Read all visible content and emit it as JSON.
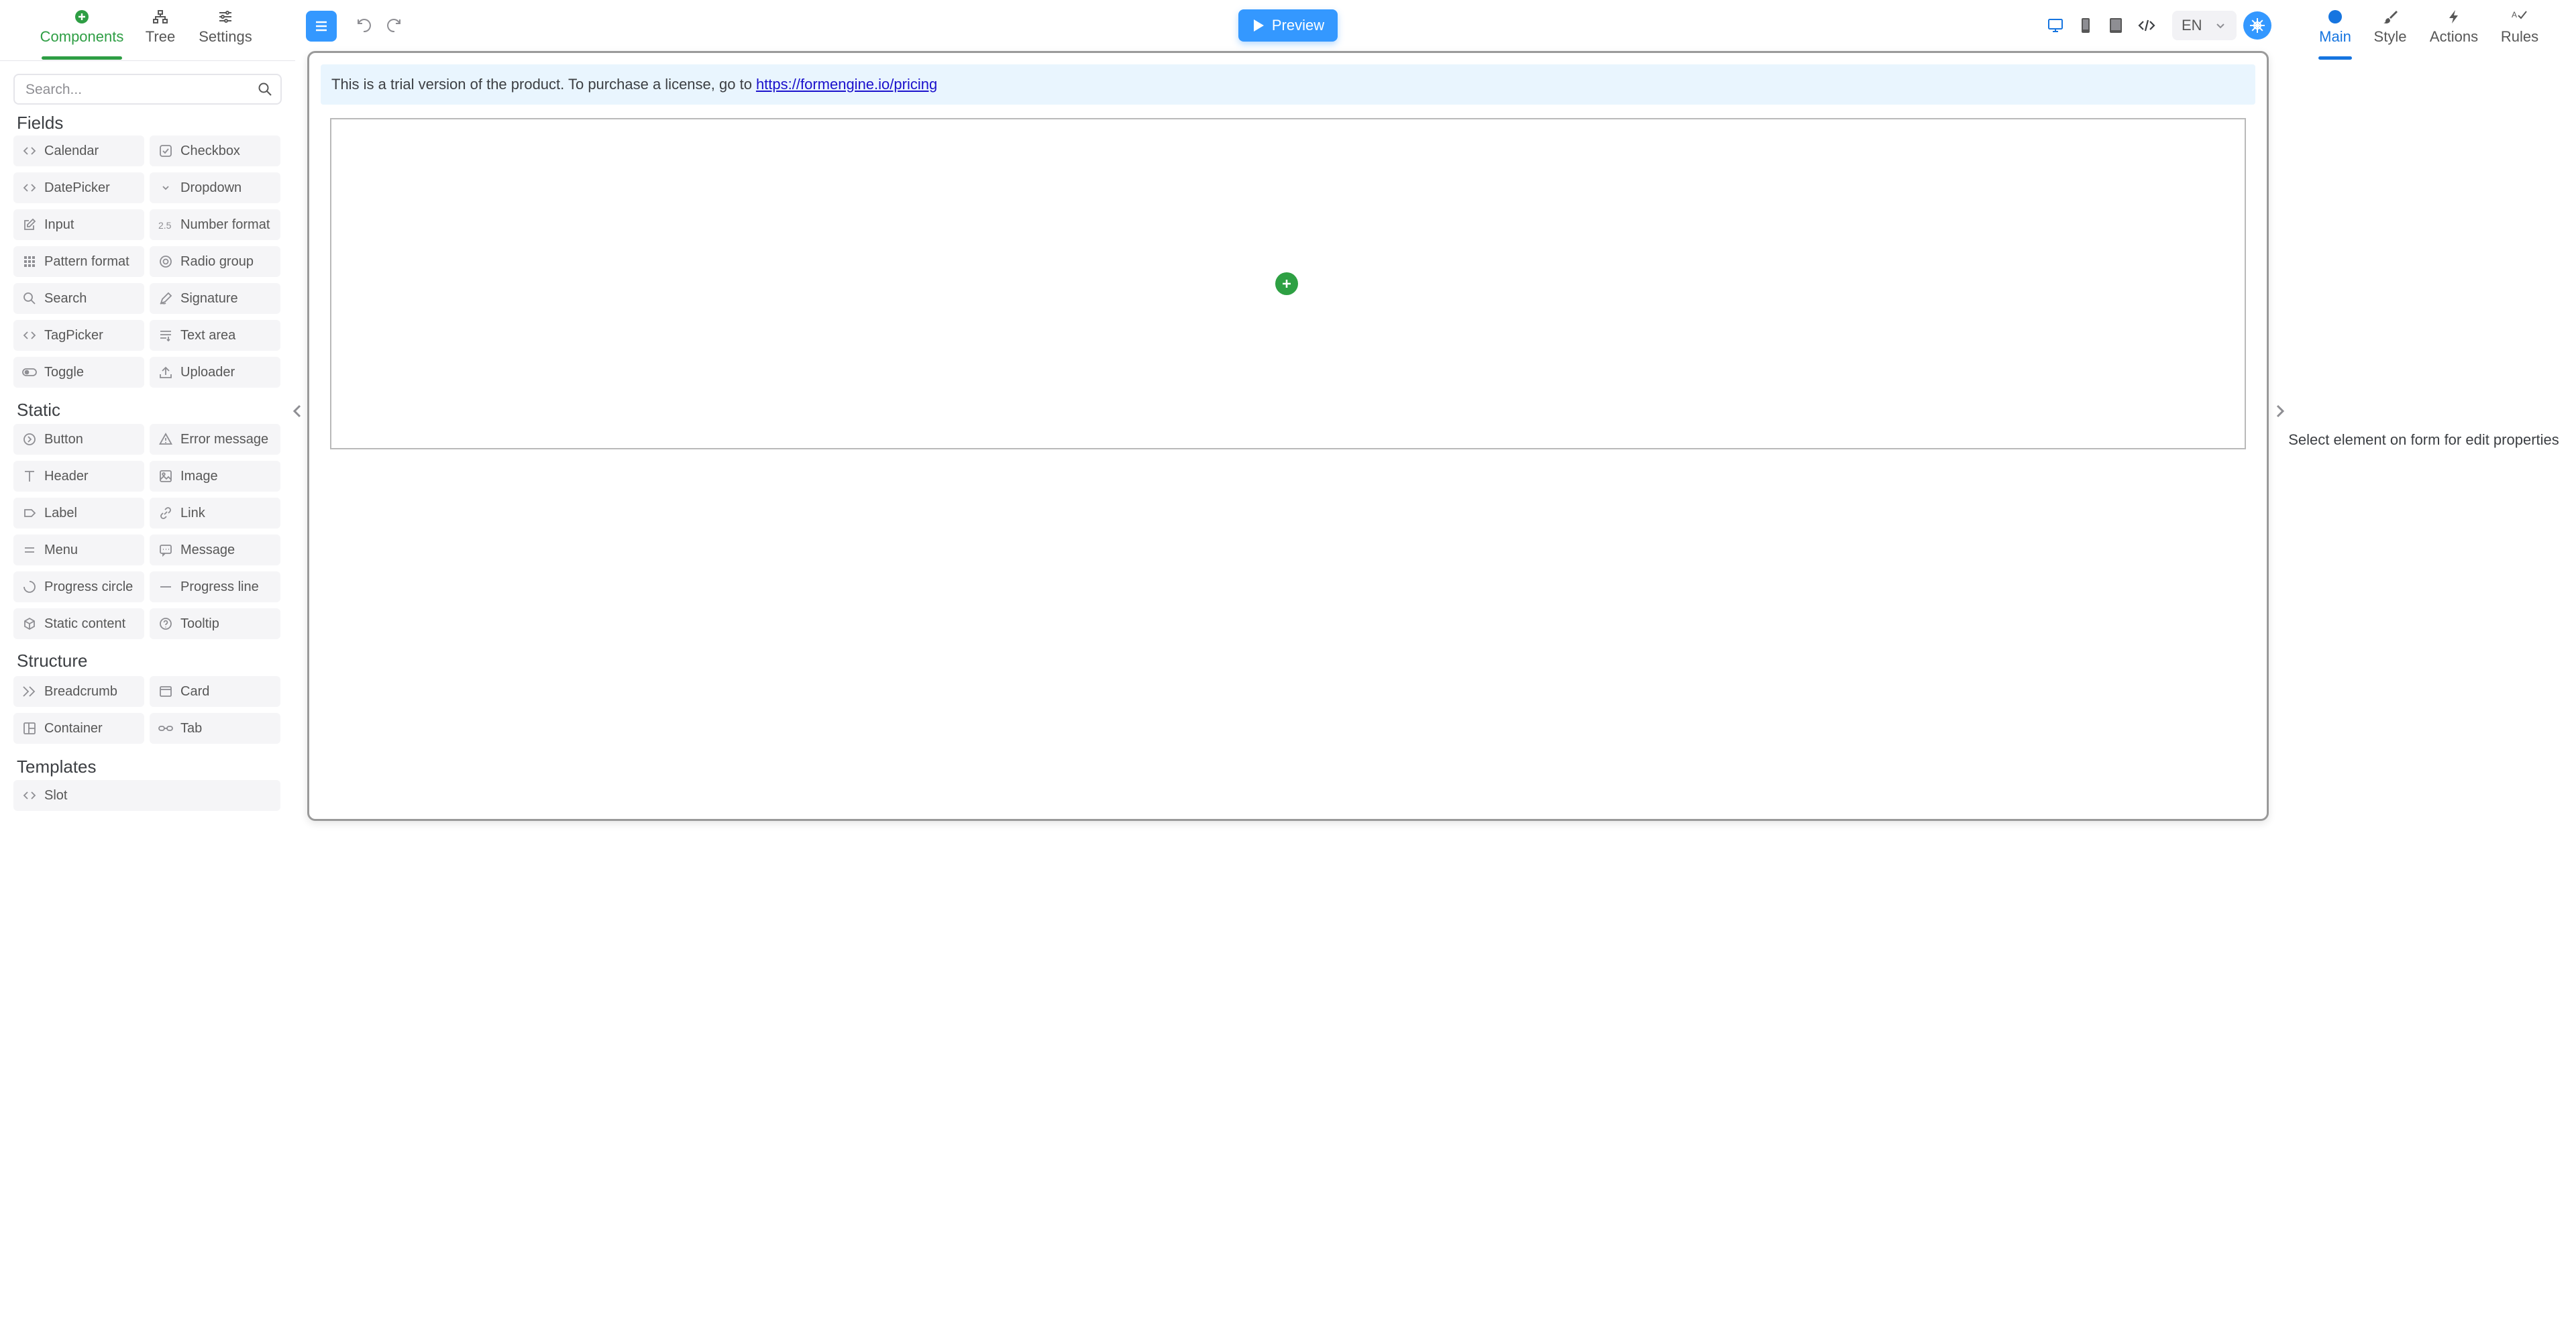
{
  "left_panel": {
    "tabs": [
      {
        "label": "Components",
        "icon": "plus-circle-icon",
        "active": true
      },
      {
        "label": "Tree",
        "icon": "tree-icon",
        "active": false
      },
      {
        "label": "Settings",
        "icon": "sliders-icon",
        "active": false
      }
    ],
    "search": {
      "placeholder": "Search...",
      "value": ""
    },
    "sections": {
      "fields": {
        "title": "Fields",
        "items": [
          {
            "label": "Calendar",
            "icon": "code-icon"
          },
          {
            "label": "Checkbox",
            "icon": "checkbox-icon"
          },
          {
            "label": "DatePicker",
            "icon": "code-icon"
          },
          {
            "label": "Dropdown",
            "icon": "chevron-down-icon"
          },
          {
            "label": "Input",
            "icon": "edit-icon"
          },
          {
            "label": "Number format",
            "icon": "number-icon"
          },
          {
            "label": "Pattern format",
            "icon": "grid-dots-icon"
          },
          {
            "label": "Radio group",
            "icon": "radio-icon"
          },
          {
            "label": "Search",
            "icon": "search-icon"
          },
          {
            "label": "Signature",
            "icon": "pen-icon"
          },
          {
            "label": "TagPicker",
            "icon": "code-icon"
          },
          {
            "label": "Text area",
            "icon": "text-lines-icon"
          },
          {
            "label": "Toggle",
            "icon": "toggle-icon"
          },
          {
            "label": "Uploader",
            "icon": "upload-icon"
          }
        ]
      },
      "static": {
        "title": "Static",
        "items": [
          {
            "label": "Button",
            "icon": "button-icon"
          },
          {
            "label": "Error message",
            "icon": "warning-icon"
          },
          {
            "label": "Header",
            "icon": "header-icon"
          },
          {
            "label": "Image",
            "icon": "image-icon"
          },
          {
            "label": "Label",
            "icon": "label-icon"
          },
          {
            "label": "Link",
            "icon": "link-icon"
          },
          {
            "label": "Menu",
            "icon": "menu-icon"
          },
          {
            "label": "Message",
            "icon": "message-icon"
          },
          {
            "label": "Progress circle",
            "icon": "progress-circle-icon"
          },
          {
            "label": "Progress line",
            "icon": "progress-line-icon"
          },
          {
            "label": "Static content",
            "icon": "cube-icon"
          },
          {
            "label": "Tooltip",
            "icon": "help-icon"
          }
        ]
      },
      "structure": {
        "title": "Structure",
        "items": [
          {
            "label": "Breadcrumb",
            "icon": "breadcrumb-icon"
          },
          {
            "label": "Card",
            "icon": "card-icon"
          },
          {
            "label": "Container",
            "icon": "container-icon"
          },
          {
            "label": "Tab",
            "icon": "tab-icon"
          }
        ]
      },
      "templates": {
        "title": "Templates",
        "items": [
          {
            "label": "Slot",
            "icon": "code-icon"
          }
        ]
      }
    }
  },
  "toolbar": {
    "menu_icon": "hamburger-icon",
    "undo_icon": "undo-icon",
    "redo_icon": "redo-icon",
    "preview_label": "Preview",
    "devices": [
      "desktop-icon",
      "mobile-icon",
      "tablet-icon",
      "code-icon"
    ],
    "active_device": "desktop-icon",
    "language": "EN",
    "theme_icon": "snowflake-icon"
  },
  "right_panel": {
    "tabs": [
      {
        "label": "Main",
        "icon": "circle-icon",
        "active": true
      },
      {
        "label": "Style",
        "icon": "brush-icon",
        "active": false
      },
      {
        "label": "Actions",
        "icon": "lightning-icon",
        "active": false
      },
      {
        "label": "Rules",
        "icon": "rules-icon",
        "active": false
      }
    ],
    "empty_hint": "Select element on form for edit properties"
  },
  "canvas": {
    "trial_text": "This is a trial version of the product. To purchase a license, go to",
    "trial_link": "https://formengine.io/pricing"
  },
  "colors": {
    "accent_blue": "#3498ff",
    "active_tab_green": "#2e9e44",
    "active_tab_blue": "#1675e0",
    "banner_bg": "#e9f5fe",
    "add_button_green": "#2ea043"
  }
}
